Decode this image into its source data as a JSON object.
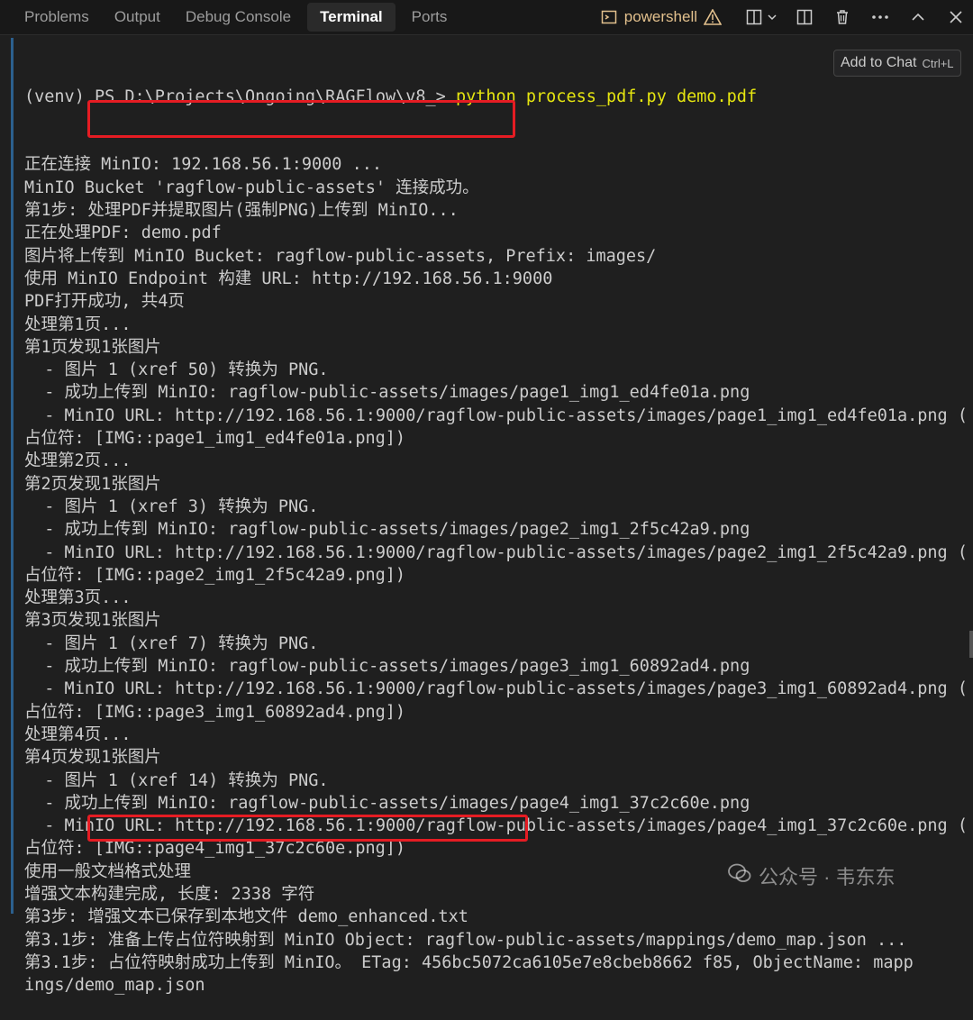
{
  "tabs": [
    {
      "label": "Problems",
      "active": false
    },
    {
      "label": "Output",
      "active": false
    },
    {
      "label": "Debug Console",
      "active": false
    },
    {
      "label": "Terminal",
      "active": true
    },
    {
      "label": "Ports",
      "active": false
    }
  ],
  "toolbar": {
    "shell_name": "powershell",
    "icons": [
      "terminal-icon",
      "warning-icon",
      "split-icon",
      "chevron-down-icon",
      "layout-icon",
      "trash-icon",
      "more-icon",
      "chevron-up-icon",
      "close-icon"
    ]
  },
  "tooltip": {
    "label": "Add to Chat",
    "shortcut": "Ctrl+L"
  },
  "terminal": {
    "prompt": "(venv) PS D:\\Projects\\Ongoing\\RAGFlow\\v8_> ",
    "command": "python process_pdf.py demo.pdf",
    "lines": [
      "正在连接 MinIO: 192.168.56.1:9000 ...",
      "MinIO Bucket 'ragflow-public-assets' 连接成功。",
      "第1步: 处理PDF并提取图片(强制PNG)上传到 MinIO...",
      "正在处理PDF: demo.pdf",
      "图片将上传到 MinIO Bucket: ragflow-public-assets, Prefix: images/",
      "使用 MinIO Endpoint 构建 URL: http://192.168.56.1:9000",
      "PDF打开成功, 共4页",
      "处理第1页...",
      "第1页发现1张图片",
      "  - 图片 1 (xref 50) 转换为 PNG.",
      "  - 成功上传到 MinIO: ragflow-public-assets/images/page1_img1_ed4fe01a.png",
      "  - MinIO URL: http://192.168.56.1:9000/ragflow-public-assets/images/page1_img1_ed4fe01a.png (",
      "占位符: [IMG::page1_img1_ed4fe01a.png])",
      "处理第2页...",
      "第2页发现1张图片",
      "  - 图片 1 (xref 3) 转换为 PNG.",
      "  - 成功上传到 MinIO: ragflow-public-assets/images/page2_img1_2f5c42a9.png",
      "  - MinIO URL: http://192.168.56.1:9000/ragflow-public-assets/images/page2_img1_2f5c42a9.png (",
      "占位符: [IMG::page2_img1_2f5c42a9.png])",
      "处理第3页...",
      "第3页发现1张图片",
      "  - 图片 1 (xref 7) 转换为 PNG.",
      "  - 成功上传到 MinIO: ragflow-public-assets/images/page3_img1_60892ad4.png",
      "  - MinIO URL: http://192.168.56.1:9000/ragflow-public-assets/images/page3_img1_60892ad4.png (",
      "占位符: [IMG::page3_img1_60892ad4.png])",
      "处理第4页...",
      "第4页发现1张图片",
      "  - 图片 1 (xref 14) 转换为 PNG.",
      "  - 成功上传到 MinIO: ragflow-public-assets/images/page4_img1_37c2c60e.png",
      "  - MinIO URL: http://192.168.56.1:9000/ragflow-public-assets/images/page4_img1_37c2c60e.png (",
      "占位符: [IMG::page4_img1_37c2c60e.png])",
      "使用一般文档格式处理",
      "增强文本构建完成, 长度: 2338 字符",
      "第3步: 增强文本已保存到本地文件 demo_enhanced.txt",
      "第3.1步: 准备上传占位符映射到 MinIO Object: ragflow-public-assets/mappings/demo_map.json ...",
      "第3.1步: 占位符映射成功上传到 MinIO。 ETag: 456bc5072ca6105e7e8cbeb8662 f85, ObjectName: mapp",
      "ings/demo_map.json"
    ]
  },
  "watermark": {
    "label": "公众号 · 韦东东"
  },
  "colors": {
    "background": "#1f1f1f",
    "command": "#e5e510",
    "highlight": "#e51c23",
    "shell": "#e2c08d"
  }
}
